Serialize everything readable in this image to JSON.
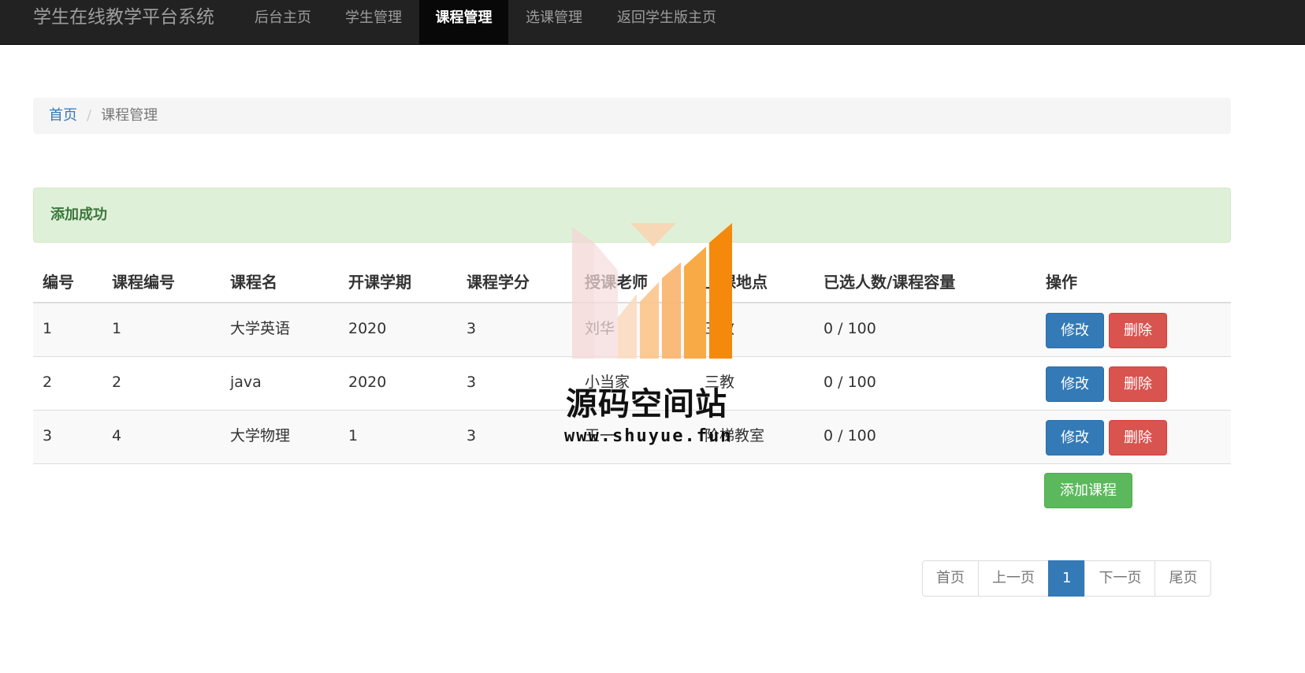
{
  "navbar": {
    "brand": "学生在线教学平台系统",
    "items": [
      {
        "label": "后台主页",
        "active": false
      },
      {
        "label": "学生管理",
        "active": false
      },
      {
        "label": "课程管理",
        "active": true
      },
      {
        "label": "选课管理",
        "active": false
      },
      {
        "label": "返回学生版主页",
        "active": false
      }
    ]
  },
  "breadcrumb": {
    "home": "首页",
    "separator": "/",
    "current": "课程管理"
  },
  "alert": {
    "message": "添加成功",
    "color": "#dff0d8"
  },
  "table": {
    "headers": [
      "编号",
      "课程编号",
      "课程名",
      "开课学期",
      "课程学分",
      "授课老师",
      "上课地点",
      "已选人数/课程容量",
      "操作"
    ],
    "rows": [
      {
        "id": "1",
        "code": "1",
        "name": "大学英语",
        "term": "2020",
        "credit": "3",
        "teacher": "刘华",
        "location": "三教",
        "enrollment": "0 / 100"
      },
      {
        "id": "2",
        "code": "2",
        "name": "java",
        "term": "2020",
        "credit": "3",
        "teacher": "小当家",
        "location": "三教",
        "enrollment": "0 / 100"
      },
      {
        "id": "3",
        "code": "4",
        "name": "大学物理",
        "term": "1",
        "credit": "3",
        "teacher": "王一",
        "location": "阶梯教室",
        "enrollment": "0 / 100"
      }
    ],
    "edit_label": "修改",
    "delete_label": "删除",
    "add_label": "添加课程"
  },
  "pagination": {
    "first": "首页",
    "prev": "上一页",
    "current": "1",
    "next": "下一页",
    "last": "尾页"
  },
  "watermark": {
    "title": "源码空间站",
    "url": "www.shuyue.fun"
  },
  "colors": {
    "navbar_bg": "#222222",
    "primary": "#337ab7",
    "danger": "#d9534f",
    "success": "#5cb85c"
  }
}
